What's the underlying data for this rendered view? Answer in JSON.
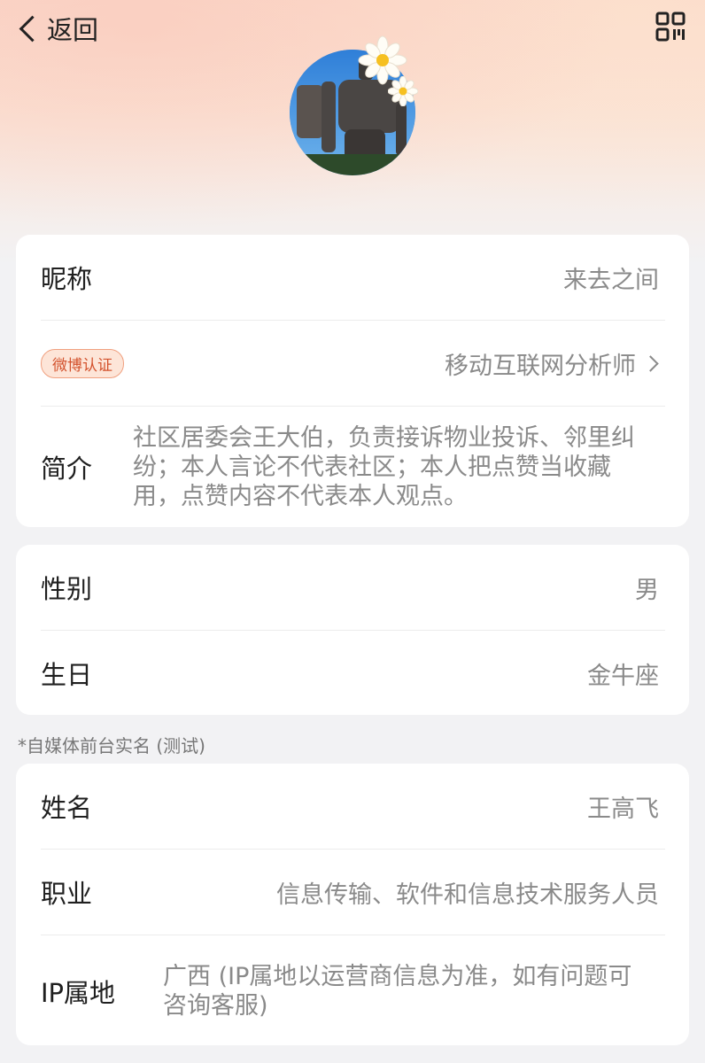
{
  "nav": {
    "back_label": "返回"
  },
  "profile": {
    "nickname_label": "昵称",
    "nickname_value": "来去之间",
    "verify_badge": "微博认证",
    "verify_value": "移动互联网分析师",
    "bio_label": "简介",
    "bio_value": "社区居委会王大伯，负责接诉物业投诉、邻里纠纷；本人言论不代表社区；本人把点赞当收藏用，点赞内容不代表本人观点。"
  },
  "basic": {
    "gender_label": "性别",
    "gender_value": "男",
    "birthday_label": "生日",
    "birthday_value": "金牛座"
  },
  "realname": {
    "section_note": "*自媒体前台实名 (测试)",
    "name_label": "姓名",
    "name_value": "王高飞",
    "job_label": "职业",
    "job_value": "信息传输、软件和信息技术服务人员",
    "ip_label": "IP属地",
    "ip_value": "广西 (IP属地以运营商信息为准，如有问题可咨询客服)"
  },
  "icons": {
    "back": "chevron-left-icon",
    "qr": "qr-code-icon",
    "arrow": "chevron-right-icon"
  },
  "colors": {
    "badge_text": "#d3522d",
    "badge_bg": "#fde5d8",
    "secondary_text": "#8a8a8a"
  }
}
